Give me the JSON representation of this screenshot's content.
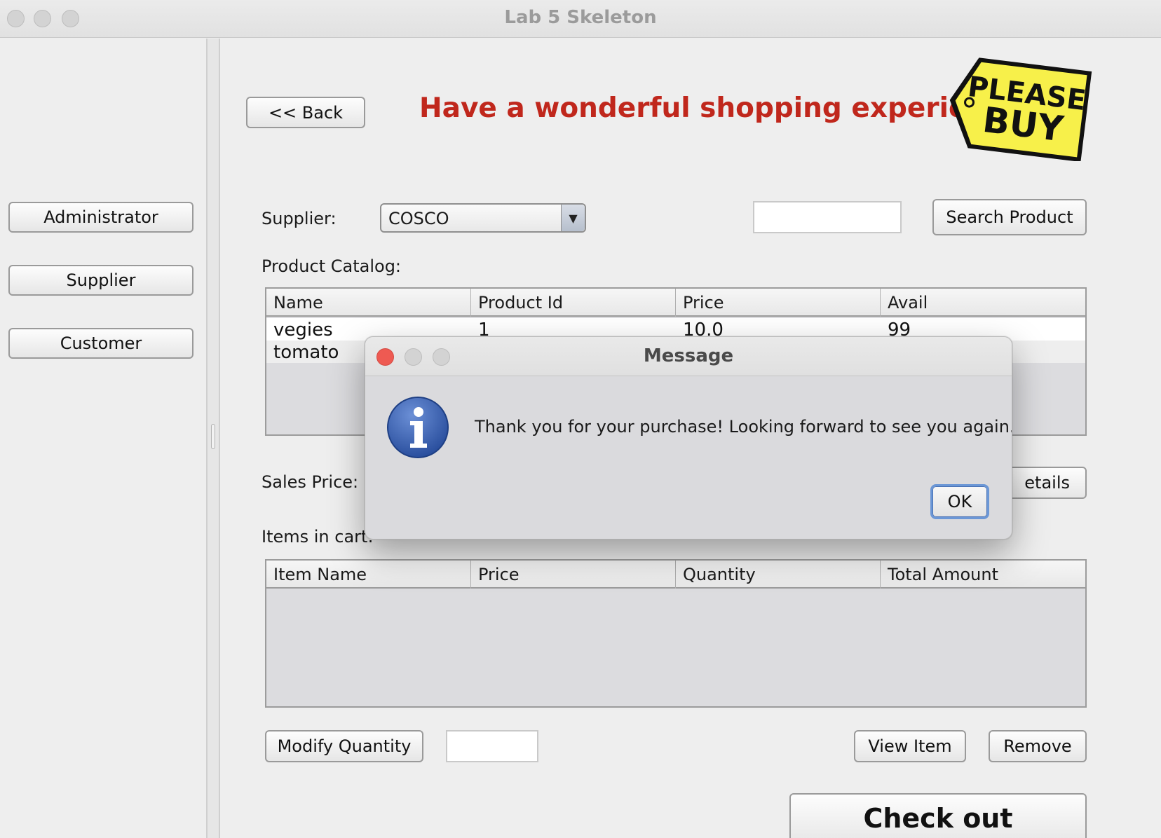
{
  "window": {
    "title": "Lab 5 Skeleton"
  },
  "sidebar": {
    "items": [
      {
        "label": "Administrator"
      },
      {
        "label": "Supplier"
      },
      {
        "label": "Customer"
      }
    ]
  },
  "header": {
    "back_label": "<< Back",
    "headline": "Have a wonderful shopping experience!",
    "logo": {
      "line1": "PLEASE",
      "line2": "BUY",
      "color": "#f7f04a"
    }
  },
  "supplier": {
    "label": "Supplier:",
    "selected": "COSCO",
    "search_value": "",
    "search_label": "Search Product"
  },
  "catalog": {
    "label": "Product Catalog:",
    "columns": [
      "Name",
      "Product Id",
      "Price",
      "Avail"
    ],
    "rows": [
      [
        "vegies",
        "1",
        "10.0",
        "99"
      ],
      [
        "tomato",
        "",
        "",
        ""
      ]
    ]
  },
  "sales": {
    "label": "Sales Price:",
    "details_label": "etails"
  },
  "cart": {
    "label": "Items in cart:",
    "columns": [
      "Item Name",
      "Price",
      "Quantity",
      "Total Amount"
    ],
    "modify_label": "Modify Quantity",
    "quantity_value": "",
    "view_label": "View Item",
    "remove_label": "Remove",
    "checkout_label": "Check out"
  },
  "dialog": {
    "title": "Message",
    "message": "Thank you for your purchase! Looking forward to see you again.",
    "ok_label": "OK",
    "icon": "info-icon"
  },
  "colors": {
    "headline": "#c0271c",
    "close_dot": "#ee5a52",
    "ok_border": "#6b97d6"
  }
}
